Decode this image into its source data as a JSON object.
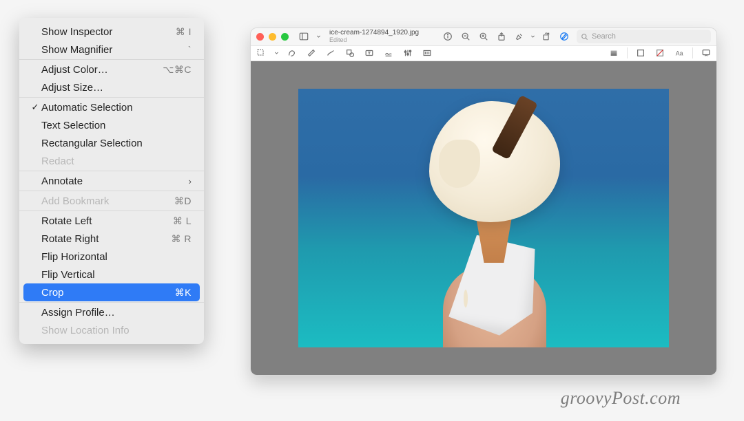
{
  "menu": {
    "groups": [
      {
        "items": [
          {
            "key": "show-inspector",
            "label": "Show Inspector",
            "shortcut": "⌘ I",
            "check": false,
            "disabled": false
          },
          {
            "key": "show-magnifier",
            "label": "Show Magnifier",
            "shortcut": "`",
            "check": false,
            "disabled": false
          }
        ]
      },
      {
        "items": [
          {
            "key": "adjust-color",
            "label": "Adjust Color…",
            "shortcut": "⌥⌘C",
            "check": false,
            "disabled": false
          },
          {
            "key": "adjust-size",
            "label": "Adjust Size…",
            "shortcut": "",
            "check": false,
            "disabled": false
          }
        ]
      },
      {
        "items": [
          {
            "key": "automatic-selection",
            "label": "Automatic Selection",
            "shortcut": "",
            "check": true,
            "disabled": false
          },
          {
            "key": "text-selection",
            "label": "Text Selection",
            "shortcut": "",
            "check": false,
            "disabled": false
          },
          {
            "key": "rectangular-selection",
            "label": "Rectangular Selection",
            "shortcut": "",
            "check": false,
            "disabled": false
          },
          {
            "key": "redact",
            "label": "Redact",
            "shortcut": "",
            "check": false,
            "disabled": true
          }
        ]
      },
      {
        "items": [
          {
            "key": "annotate",
            "label": "Annotate",
            "shortcut": "",
            "submenu": true,
            "check": false,
            "disabled": false
          }
        ]
      },
      {
        "items": [
          {
            "key": "add-bookmark",
            "label": "Add Bookmark",
            "shortcut": "⌘D",
            "check": false,
            "disabled": true
          }
        ]
      },
      {
        "items": [
          {
            "key": "rotate-left",
            "label": "Rotate Left",
            "shortcut": "⌘ L",
            "check": false,
            "disabled": false
          },
          {
            "key": "rotate-right",
            "label": "Rotate Right",
            "shortcut": "⌘ R",
            "check": false,
            "disabled": false
          },
          {
            "key": "flip-horizontal",
            "label": "Flip Horizontal",
            "shortcut": "",
            "check": false,
            "disabled": false
          },
          {
            "key": "flip-vertical",
            "label": "Flip Vertical",
            "shortcut": "",
            "check": false,
            "disabled": false
          },
          {
            "key": "crop",
            "label": "Crop",
            "shortcut": "⌘K",
            "check": false,
            "disabled": false,
            "highlighted": true
          }
        ]
      },
      {
        "items": [
          {
            "key": "assign-profile",
            "label": "Assign Profile…",
            "shortcut": "",
            "check": false,
            "disabled": false
          },
          {
            "key": "show-location-info",
            "label": "Show Location Info",
            "shortcut": "",
            "check": false,
            "disabled": true
          }
        ]
      }
    ]
  },
  "window": {
    "filename": "ice-cream-1274894_1920.jpg",
    "status": "Edited",
    "search_placeholder": "Search"
  },
  "watermark": "groovyPost.com"
}
